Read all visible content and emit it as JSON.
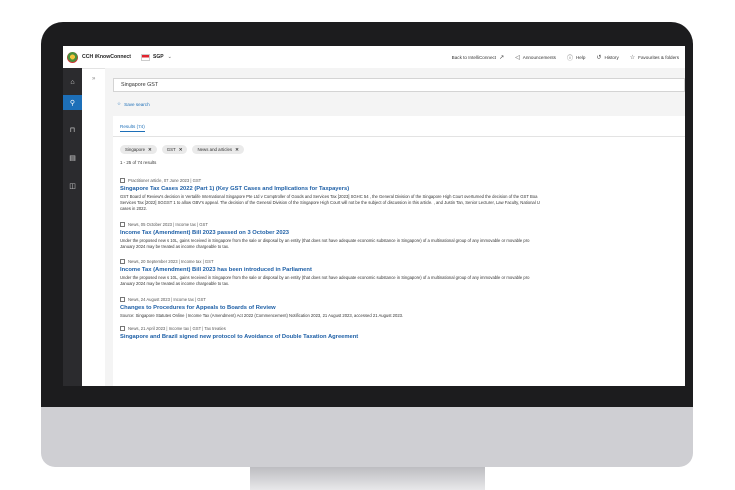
{
  "header": {
    "brand": "CCH iKnowConnect",
    "region": "SGP",
    "nav": [
      {
        "label": "Back to IntelliConnect",
        "icon": "external-link-icon"
      },
      {
        "label": "Announcements",
        "icon": "megaphone-icon"
      },
      {
        "label": "Help",
        "icon": "help-icon"
      },
      {
        "label": "History",
        "icon": "history-icon"
      },
      {
        "label": "Favourites & folders",
        "icon": "star-icon"
      }
    ]
  },
  "sidebar": {
    "items": [
      {
        "icon": "home-icon"
      },
      {
        "icon": "search-icon",
        "active": true
      },
      {
        "icon": "briefcase-icon"
      },
      {
        "icon": "news-icon"
      },
      {
        "icon": "book-icon"
      }
    ]
  },
  "search": {
    "value": "Singapore GST",
    "save_label": "Save search"
  },
  "results": {
    "tab_label": "Results (74)",
    "filters": [
      "Singapore",
      "GST",
      "News and articles"
    ],
    "count_text": "1 - 25 of 74 results",
    "items": [
      {
        "meta": "Practitioner article, 07 June 2023 | GST",
        "title": "Singapore Tax Cases 2022 (Part 1) (Key GST Cases and Implications for Taxpayers)",
        "snippet": "GST Board of Review's decision in Vertalife International Singapore Pte Ltd v Comptroller of Goods and Services Tax [2023] SGHC 54 , the General Division of the Singapore High Court overturned the decision of the GST Boa",
        "snippet2": "Services Tax [2022] SGGST 1 to allow GBV's appeal. The decision of the General Division of the Singapore High Court will not be the subject of discussion in this article. , and Justin Tan, Senior Lecturer, Law Faculty, National U",
        "snippet3": "cases in 2022."
      },
      {
        "meta": "News, 05 October 2023 | Income tax | GST",
        "title": "Income Tax (Amendment) Bill 2023 passed on 3 October 2023",
        "snippet": "Under the proposed new s 10L, gains received in Singapore from the sale or disposal by an entity (that does not have adequate economic substance in Singapore) of a multinational group of any immovable or movable pro",
        "snippet2": "January 2024 may be treated as income chargeable to tax."
      },
      {
        "meta": "News, 20 September 2023 | Income tax | GST",
        "title": "Income Tax (Amendment) Bill 2023 has been introduced in Parliament",
        "snippet": "Under the proposed new s 10L, gains received in Singapore from the sale or disposal by an entity (that does not have adequate economic substance in Singapore) of a multinational group of any immovable or movable pro",
        "snippet2": "January 2024 may be treated as income chargeable to tax."
      },
      {
        "meta": "News, 24 August 2023 | Income tax | GST",
        "title": "Changes to Procedures for Appeals to Boards of Review",
        "snippet": "Source: Singapore Statutes Online | Income Tax (Amendment) Act 2022 (Commencement) Notification 2023, 21 August 2023, accessed 21 August 2023."
      },
      {
        "meta": "News, 21 April 2023 | Income tax | GST | Tax treaties",
        "title": "Singapore and Brazil signed new protocol to Avoidance of Double Taxation Agreement"
      }
    ]
  },
  "colors": {
    "accent": "#1d6fb8",
    "sidebar_bg": "#2b2b2e",
    "bezel": "#1c1c1e"
  }
}
